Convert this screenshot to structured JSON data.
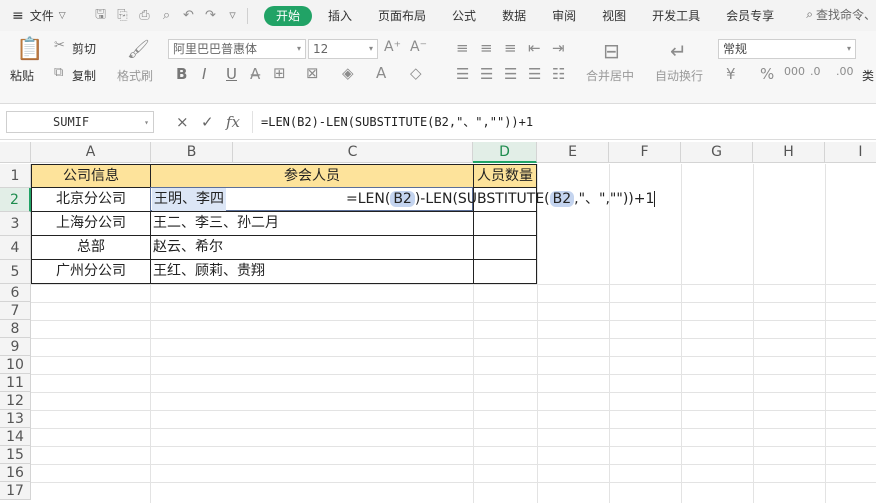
{
  "menubar": {
    "file_label": "文件",
    "tabs": [
      "开始",
      "插入",
      "页面布局",
      "公式",
      "数据",
      "审阅",
      "视图",
      "开发工具",
      "会员专享"
    ],
    "active_tab": "开始",
    "search_placeholder": "查找命令、"
  },
  "ribbon": {
    "paste": "粘贴",
    "cut": "剪切",
    "copy": "复制",
    "format_painter": "格式刷",
    "font_name": "阿里巴巴普惠体",
    "font_size": "12",
    "bold": "B",
    "italic": "I",
    "underline": "U",
    "merge_center": "合并居中",
    "wrap_text": "自动换行",
    "number_format": "常规",
    "type_convert": "类"
  },
  "formula_bar": {
    "name_box": "SUMIF",
    "cancel": "×",
    "confirm": "✓",
    "fx": "fx",
    "formula": "=LEN(B2)-LEN(SUBSTITUTE(B2,\"、\",\"\"))+1"
  },
  "sheet": {
    "columns": [
      "A",
      "B",
      "C",
      "D",
      "E",
      "F",
      "G",
      "H",
      "I"
    ],
    "rows": [
      "1",
      "2",
      "3",
      "4",
      "5",
      "6",
      "7",
      "8",
      "9",
      "10",
      "11",
      "12",
      "13",
      "14",
      "15",
      "16",
      "17"
    ],
    "header": {
      "a": "公司信息",
      "bc": "参会人员",
      "d": "人员数量"
    },
    "data": [
      {
        "company": "北京分公司",
        "people": "王明、李四"
      },
      {
        "company": "上海分公司",
        "people": "王二、李三、孙二月"
      },
      {
        "company": "总部",
        "people": "赵云、希尔"
      },
      {
        "company": "广州分公司",
        "people": "王红、顾莉、贵翔"
      }
    ],
    "editing_formula": {
      "p1": "=LEN(",
      "ref1": "B2",
      "p2": ")-LEN(SUBSTITUTE(",
      "ref2": "B2",
      "p3": ",\"、\",\"\"))+1"
    }
  },
  "colors": {
    "accent": "#21a366",
    "header_fill": "#fde39b",
    "reference_highlight": "#c4d4ef"
  }
}
